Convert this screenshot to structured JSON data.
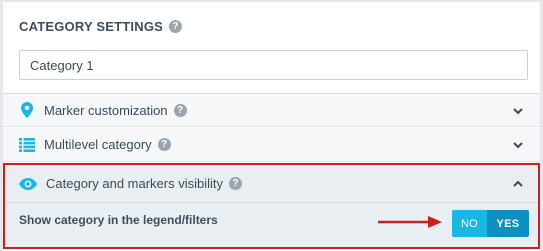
{
  "settings": {
    "title": "CATEGORY SETTINGS",
    "help_glyph": "?",
    "name_value": "Category 1"
  },
  "rows": [
    {
      "label": "Marker customization",
      "icon": "map-pin-icon",
      "state": "collapsed"
    },
    {
      "label": "Multilevel category",
      "icon": "list-icon",
      "state": "collapsed"
    }
  ],
  "visibility": {
    "label": "Category and markers visibility",
    "icon": "eye-icon",
    "state": "expanded",
    "show_label": "Show category in the legend/filters",
    "toggle": {
      "no": "NO",
      "yes": "YES",
      "selected": "YES"
    }
  },
  "colors": {
    "accent": "#19b7e5",
    "accent_dark": "#0e8fc4",
    "highlight": "#cc1f1f"
  }
}
